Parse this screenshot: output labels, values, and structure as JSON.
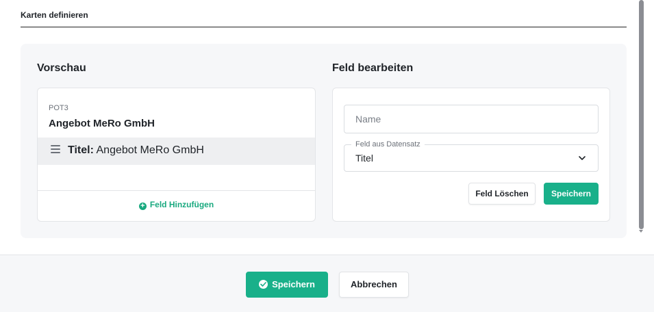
{
  "tab": {
    "label": "Karten definieren"
  },
  "preview": {
    "section_title": "Vorschau",
    "card_subtitle": "POT3",
    "card_title": "Angebot MeRo GmbH",
    "field": {
      "key": "Titel:",
      "value": "Angebot MeRo GmbH"
    },
    "add_field_label": "Feld Hinzufügen"
  },
  "edit": {
    "section_title": "Feld bearbeiten",
    "name_placeholder": "Name",
    "name_value": "",
    "record_field_label": "Feld aus Datensatz",
    "record_field_value": "Titel",
    "delete_label": "Feld Löschen",
    "save_label": "Speichern"
  },
  "footer": {
    "save_label": "Speichern",
    "cancel_label": "Abbrechen"
  },
  "colors": {
    "accent": "#19b08a",
    "panel_bg": "#f6f7f9",
    "border": "#e3e5e8"
  },
  "icons": {
    "drag": "drag-handle-icon",
    "chevron": "chevron-down-icon",
    "add": "plus-circle-icon",
    "check": "check-circle-icon"
  }
}
